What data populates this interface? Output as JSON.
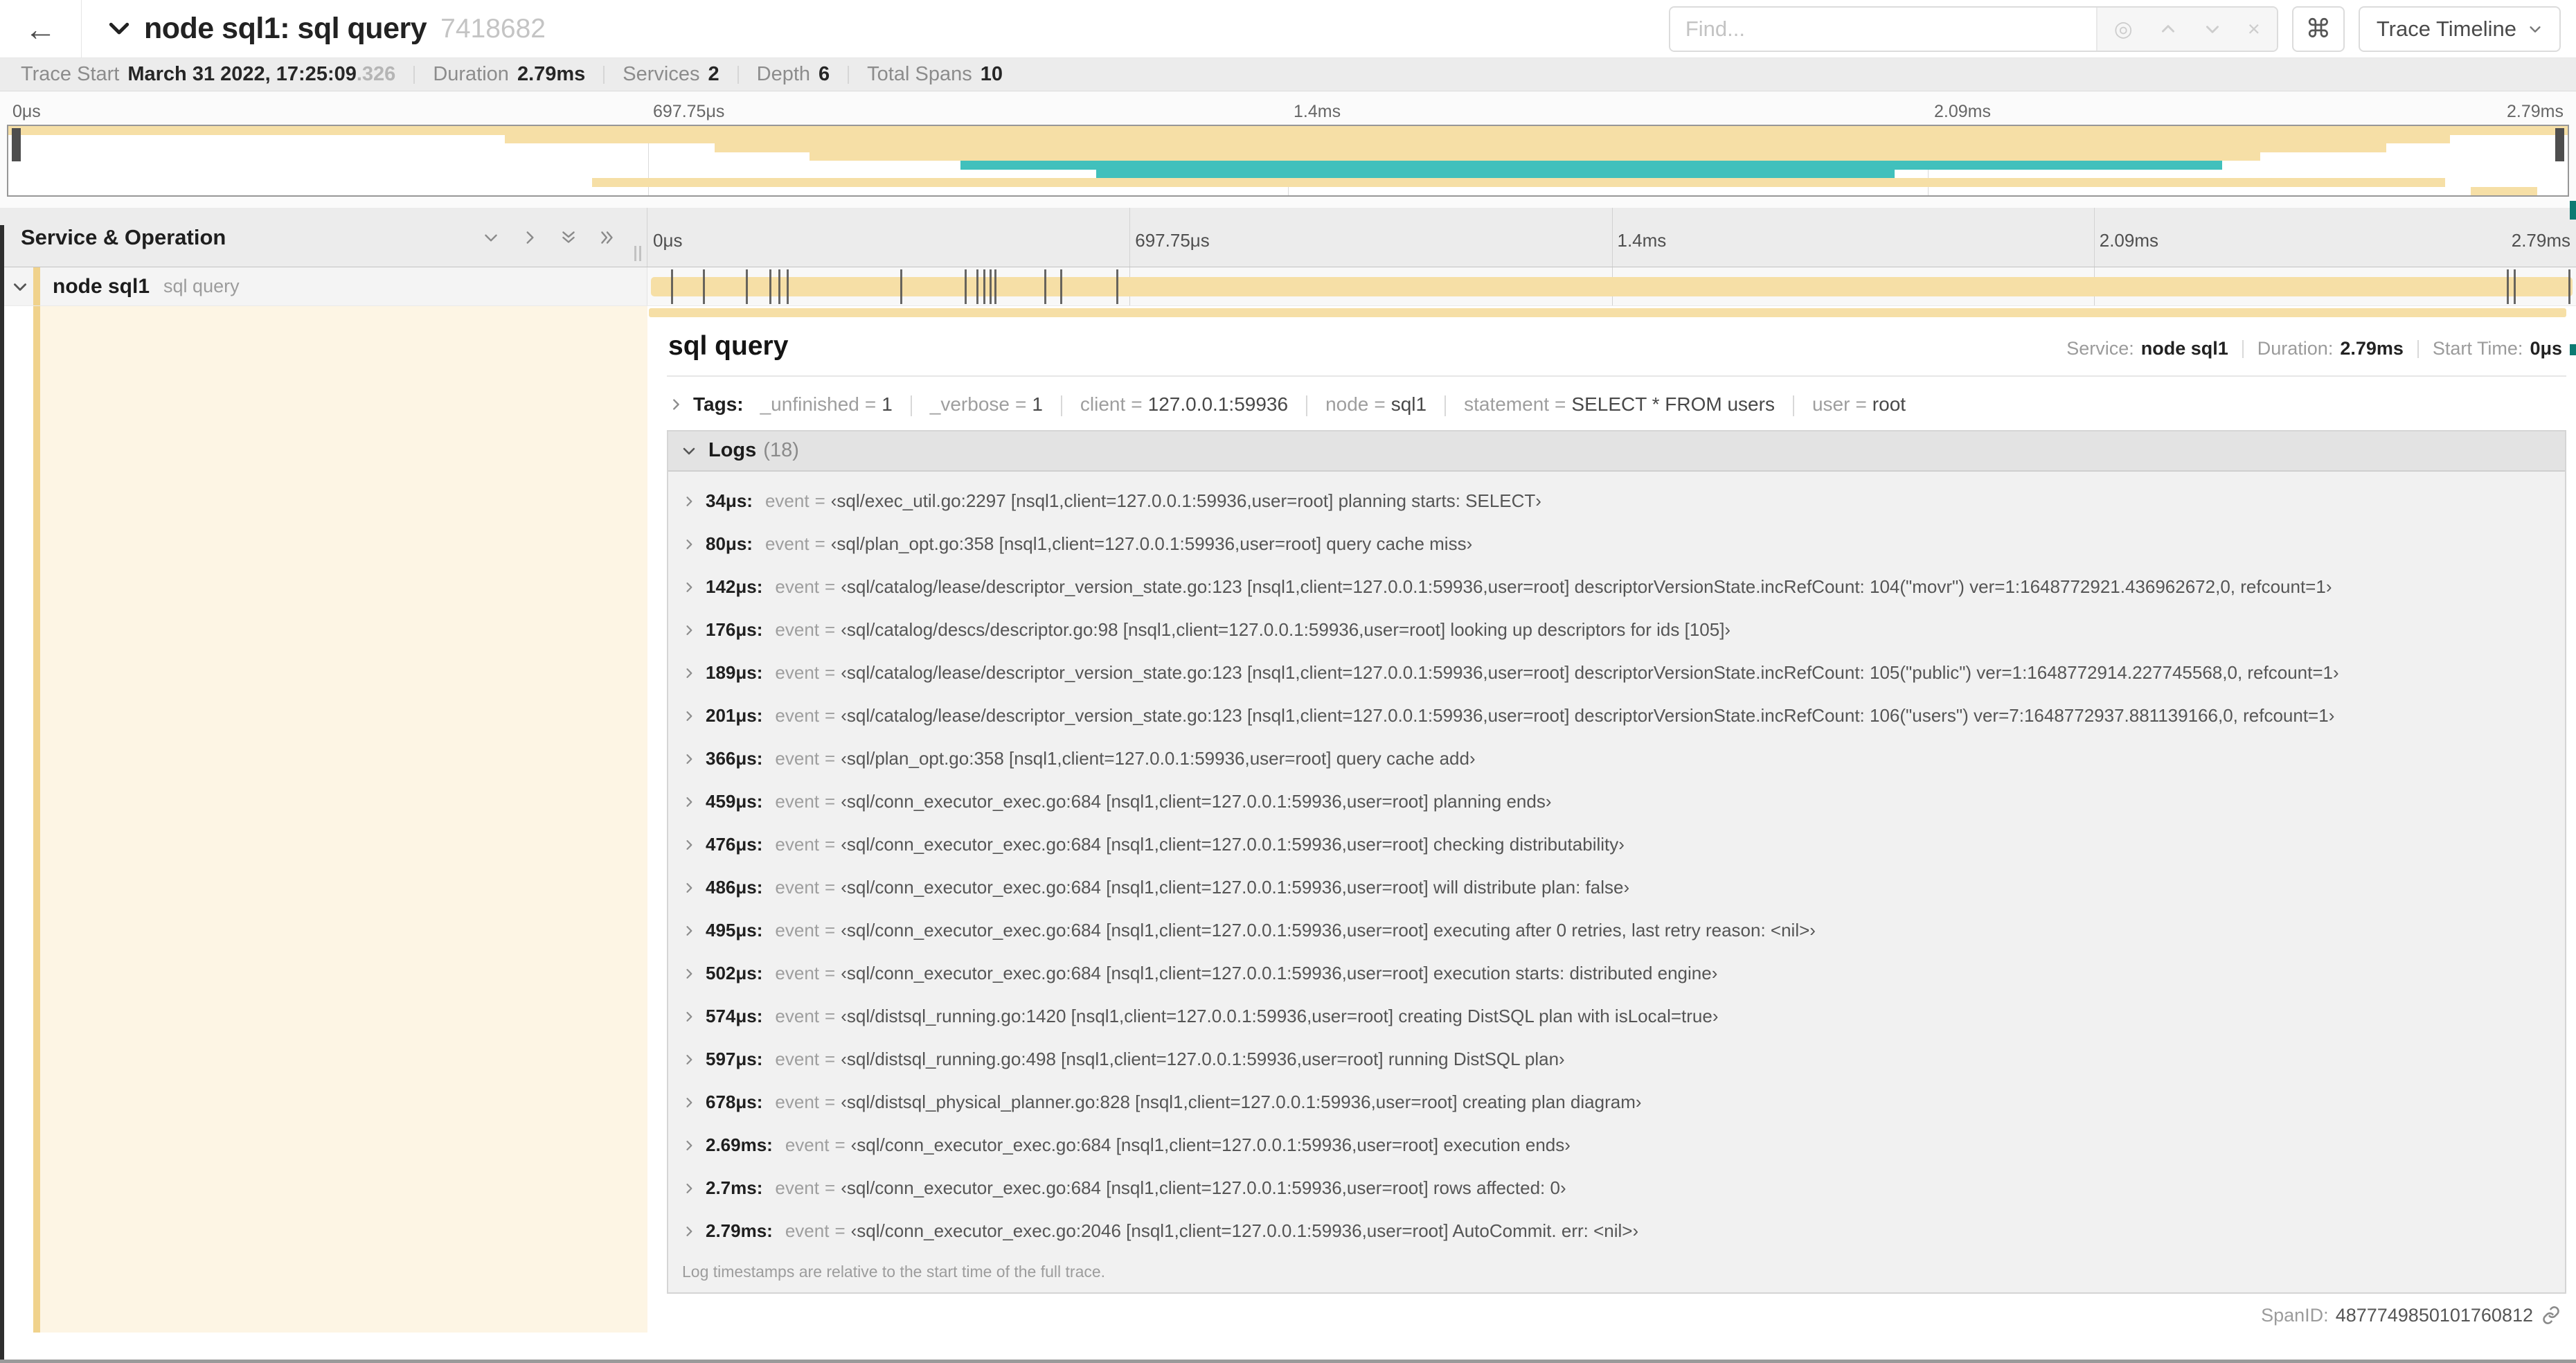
{
  "header": {
    "back_icon": "arrow-left",
    "title": "node sql1: sql query",
    "trace_id": "7418682",
    "find_placeholder": "Find...",
    "cmd_symbol": "⌘",
    "view_dropdown_label": "Trace Timeline",
    "find_icons": [
      "locate-icon",
      "chevron-up-icon",
      "chevron-down-icon",
      "close-icon"
    ],
    "locate_glyph": "◎",
    "close_glyph": "×"
  },
  "summary": {
    "items": [
      {
        "label": "Trace Start",
        "value": "March 31 2022, 17:25:09",
        "suffix": ".326"
      },
      {
        "label": "Duration",
        "value": "2.79ms",
        "suffix": ""
      },
      {
        "label": "Services",
        "value": "2",
        "suffix": ""
      },
      {
        "label": "Depth",
        "value": "6",
        "suffix": ""
      },
      {
        "label": "Total Spans",
        "value": "10",
        "suffix": ""
      }
    ]
  },
  "timeline": {
    "ticks": [
      "0μs",
      "697.75μs",
      "1.4ms",
      "2.09ms",
      "2.79ms"
    ],
    "duration_us": 2790,
    "minimap_spans": [
      {
        "start": 0.0,
        "end": 1.0,
        "color": "tan"
      },
      {
        "start": 0.194,
        "end": 0.954,
        "color": "tan"
      },
      {
        "start": 0.276,
        "end": 0.929,
        "color": "tan"
      },
      {
        "start": 0.313,
        "end": 0.88,
        "color": "tan"
      },
      {
        "start": 0.372,
        "end": 0.865,
        "color": "teal"
      },
      {
        "start": 0.425,
        "end": 0.737,
        "color": "teal"
      },
      {
        "start": 0.228,
        "end": 0.952,
        "color": "tan"
      },
      {
        "start": 0.962,
        "end": 0.988,
        "color": "tan"
      }
    ]
  },
  "columns": {
    "left_header": "Service & Operation"
  },
  "span_row": {
    "service": "node sql1",
    "operation": "sql query"
  },
  "detail": {
    "title": "sql query",
    "overview": {
      "service_label": "Service:",
      "service_value": "node sql1",
      "duration_label": "Duration:",
      "duration_value": "2.79ms",
      "start_label": "Start Time:",
      "start_value": "0μs"
    },
    "tags_label": "Tags:",
    "tags": [
      {
        "key": "_unfinished",
        "value": "1"
      },
      {
        "key": "_verbose",
        "value": "1"
      },
      {
        "key": "client",
        "value": "127.0.0.1:59936"
      },
      {
        "key": "node",
        "value": "sql1"
      },
      {
        "key": "statement",
        "value": "SELECT * FROM users"
      },
      {
        "key": "user",
        "value": "root"
      }
    ],
    "logs_label": "Logs",
    "logs_count": "(18)",
    "log_field_key": "event",
    "logs": [
      {
        "time": "34μs",
        "us": 34,
        "text": "‹sql/exec_util.go:2297 [nsql1,client=127.0.0.1:59936,user=root] planning starts: SELECT›"
      },
      {
        "time": "80μs",
        "us": 80,
        "text": "‹sql/plan_opt.go:358 [nsql1,client=127.0.0.1:59936,user=root] query cache miss›"
      },
      {
        "time": "142μs",
        "us": 142,
        "text": "‹sql/catalog/lease/descriptor_version_state.go:123 [nsql1,client=127.0.0.1:59936,user=root] descriptorVersionState.incRefCount: 104(\"movr\") ver=1:1648772921.436962672,0, refcount=1›"
      },
      {
        "time": "176μs",
        "us": 176,
        "text": "‹sql/catalog/descs/descriptor.go:98 [nsql1,client=127.0.0.1:59936,user=root] looking up descriptors for ids [105]›"
      },
      {
        "time": "189μs",
        "us": 189,
        "text": "‹sql/catalog/lease/descriptor_version_state.go:123 [nsql1,client=127.0.0.1:59936,user=root] descriptorVersionState.incRefCount: 105(\"public\") ver=1:1648772914.227745568,0, refcount=1›"
      },
      {
        "time": "201μs",
        "us": 201,
        "text": "‹sql/catalog/lease/descriptor_version_state.go:123 [nsql1,client=127.0.0.1:59936,user=root] descriptorVersionState.incRefCount: 106(\"users\") ver=7:1648772937.881139166,0, refcount=1›"
      },
      {
        "time": "366μs",
        "us": 366,
        "text": "‹sql/plan_opt.go:358 [nsql1,client=127.0.0.1:59936,user=root] query cache add›"
      },
      {
        "time": "459μs",
        "us": 459,
        "text": "‹sql/conn_executor_exec.go:684 [nsql1,client=127.0.0.1:59936,user=root] planning ends›"
      },
      {
        "time": "476μs",
        "us": 476,
        "text": "‹sql/conn_executor_exec.go:684 [nsql1,client=127.0.0.1:59936,user=root] checking distributability›"
      },
      {
        "time": "486μs",
        "us": 486,
        "text": "‹sql/conn_executor_exec.go:684 [nsql1,client=127.0.0.1:59936,user=root] will distribute plan: false›"
      },
      {
        "time": "495μs",
        "us": 495,
        "text": "‹sql/conn_executor_exec.go:684 [nsql1,client=127.0.0.1:59936,user=root] executing after 0 retries, last retry reason: <nil>›"
      },
      {
        "time": "502μs",
        "us": 502,
        "text": "‹sql/conn_executor_exec.go:684 [nsql1,client=127.0.0.1:59936,user=root] execution starts: distributed engine›"
      },
      {
        "time": "574μs",
        "us": 574,
        "text": "‹sql/distsql_running.go:1420 [nsql1,client=127.0.0.1:59936,user=root] creating DistSQL plan with isLocal=true›"
      },
      {
        "time": "597μs",
        "us": 597,
        "text": "‹sql/distsql_running.go:498 [nsql1,client=127.0.0.1:59936,user=root] running DistSQL plan›"
      },
      {
        "time": "678μs",
        "us": 678,
        "text": "‹sql/distsql_physical_planner.go:828 [nsql1,client=127.0.0.1:59936,user=root] creating plan diagram›"
      },
      {
        "time": "2.69ms",
        "us": 2690,
        "text": "‹sql/conn_executor_exec.go:684 [nsql1,client=127.0.0.1:59936,user=root] execution ends›"
      },
      {
        "time": "2.7ms",
        "us": 2700,
        "text": "‹sql/conn_executor_exec.go:684 [nsql1,client=127.0.0.1:59936,user=root] rows affected: 0›"
      },
      {
        "time": "2.79ms",
        "us": 2790,
        "text": "‹sql/conn_executor_exec.go:2046 [nsql1,client=127.0.0.1:59936,user=root] AutoCommit. err: <nil>›"
      }
    ],
    "logs_footer": "Log timestamps are relative to the start time of the full trace.",
    "span_id_label": "SpanID:",
    "span_id": "4877749850101760812"
  },
  "colors": {
    "tan": "#f6dfa6",
    "tan_strong": "#f0d28c",
    "cream": "#fdf5e4",
    "teal": "#41c0bc",
    "scroll_teal": "#0c7a72"
  }
}
